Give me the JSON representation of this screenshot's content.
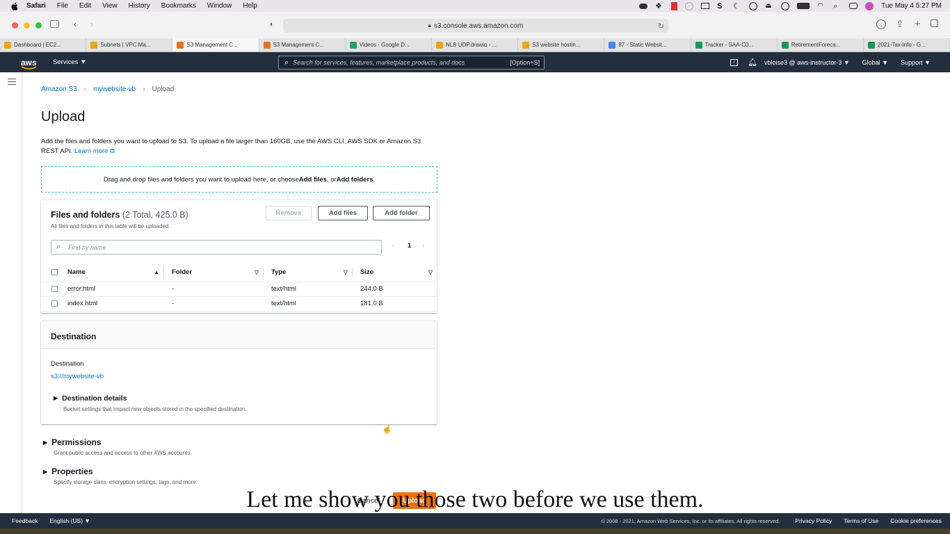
{
  "menubar": {
    "app": "Safari",
    "items": [
      "File",
      "Edit",
      "View",
      "History",
      "Bookmarks",
      "Window",
      "Help"
    ],
    "clock": "Tue May 4  5:27 PM"
  },
  "browser": {
    "url": "s3.console.aws.amazon.com",
    "tabs": [
      {
        "label": "Dashboard | EC2...",
        "color": "#f0a30a"
      },
      {
        "label": "Subnets | VPC Ma...",
        "color": "#f0a30a"
      },
      {
        "label": "S3 Management C...",
        "color": "#e8711a"
      },
      {
        "label": "S3 Management C...",
        "color": "#e8711a"
      },
      {
        "label": "Videos - Google D...",
        "color": "#1fa463"
      },
      {
        "label": "NLB UDP.drawio - ...",
        "color": "#f0a30a"
      },
      {
        "label": "S3 website hostin...",
        "color": "#f0a30a"
      },
      {
        "label": "87 - Static Websit...",
        "color": "#4285f4"
      },
      {
        "label": "Tracker - SAA-C0...",
        "color": "#0f9d58"
      },
      {
        "label": "RetirementForeca...",
        "color": "#0f9d58"
      },
      {
        "label": "2021-Tax-Info - G...",
        "color": "#0f9d58"
      }
    ]
  },
  "aws_nav": {
    "logo": "aws",
    "services": "Services ▼",
    "search_placeholder": "Search for services, features, marketplace products, and docs",
    "search_shortcut": "[Option+S]",
    "user": "vbloise3 @ aws-instructor-3 ▼",
    "region": "Global ▼",
    "support": "Support ▼"
  },
  "breadcrumb": {
    "root": "Amazon S3",
    "bucket": "mywebsite-vb",
    "current": "Upload"
  },
  "page": {
    "title": "Upload",
    "intro": "Add the files and folders you want to upload to S3. To upload a file larger than 160GB, use the AWS CLI, AWS SDK or Amazon S3 REST API.",
    "learn_more": "Learn more",
    "drop_text_1": "Drag and drop files and folders you want to upload here, or choose ",
    "drop_add_files": "Add files",
    "drop_or": ", or ",
    "drop_add_folders": "Add folders",
    "drop_end": "."
  },
  "files_panel": {
    "title": "Files and folders",
    "count": "(2 Total, 425.0 B)",
    "subtitle": "All files and folders in this table will be uploaded.",
    "remove_label": "Remove",
    "add_files_label": "Add files",
    "add_folder_label": "Add folder",
    "filter_placeholder": "Find by name",
    "page": "1",
    "columns": [
      "Name",
      "Folder",
      "Type",
      "Size"
    ],
    "rows": [
      {
        "name": "error.html",
        "folder": "-",
        "type": "text/html",
        "size": "244.0 B"
      },
      {
        "name": "index.html",
        "folder": "-",
        "type": "text/html",
        "size": "181.0 B"
      }
    ]
  },
  "destination": {
    "heading": "Destination",
    "label": "Destination",
    "value": "s3://mywebsite-vb",
    "details_title": "Destination details",
    "details_sub": "Bucket settings that impact new objects stored in the specified destination."
  },
  "permissions": {
    "title": "Permissions",
    "sub": "Grant public access and access to other AWS accounts."
  },
  "properties": {
    "title": "Properties",
    "sub": "Specify storage class, encryption settings, tags, and more."
  },
  "actions": {
    "cancel": "Cancel",
    "upload": "Upload"
  },
  "footer": {
    "feedback": "Feedback",
    "language": "English (US) ▼",
    "copyright": "© 2008 - 2021, Amazon Web Services, Inc. or its affiliates. All rights reserved.",
    "privacy": "Privacy Policy",
    "terms": "Terms of Use",
    "cookies": "Cookie preferences"
  },
  "caption": "Let me show you those two before we use them.",
  "colors": {
    "aws_nav": "#232f3e",
    "link": "#0073bb",
    "accent": "#ec7211"
  }
}
